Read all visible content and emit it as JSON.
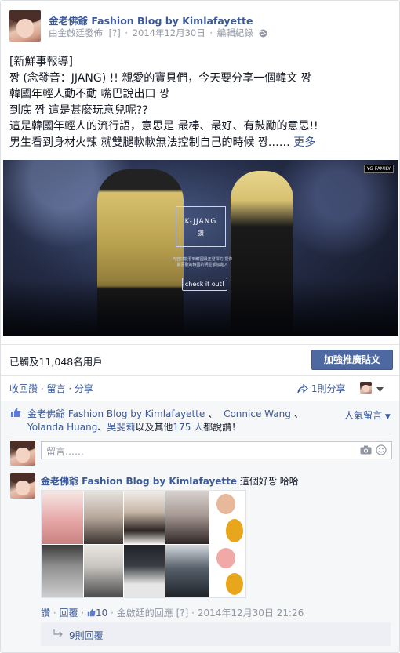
{
  "post": {
    "author": "金老佛爺 Fashion Blog by Kimlafayette",
    "meta_prefix": "由金啟廷發佈",
    "meta_help": "[?]",
    "date": "2014年12月30日",
    "edit_history": "編輯紀錄",
    "lines": [
      "[新鮮事報導]",
      "짱 (念發音：JJANG) !! 親愛的寶貝們，今天要分享一個韓文 짱",
      "韓國年輕人動不動 嘴巴說出口 짱",
      "到底 짱 這是甚麼玩意兒呢??",
      "這是韓國年輕人的流行語，意思是 最棒、最好、有鼓勵的意思!!",
      "男生看到身材火辣 就雙腿軟軟無法控制自己的時候 짱……"
    ],
    "more": "更多"
  },
  "hero": {
    "box_title": "K-JJANG",
    "box_sub": "讚",
    "box_tagline": "內容只能看到韓國最正發揮力 把你最喜歡的韓國的明星都加進入",
    "cta": "check it out!",
    "tag": "YG FAMILY"
  },
  "stats": {
    "reach": "已觸及11,048名用戶",
    "boost_label": "加強推廣貼文"
  },
  "actions": {
    "comment": "收回讚",
    "reply": "留言",
    "share": "分享",
    "shares": "1則分享",
    "sep": "·"
  },
  "likes": {
    "text_a": "金老佛爺 Fashion Blog by Kimlafayette",
    "sep1": "、",
    "text_b": "Connice Wang",
    "sep2": "、",
    "text_c": "Yolanda Huang",
    "sep3": "、",
    "text_d": "吳斐莉",
    "mid": "以及其他",
    "count": "175 人",
    "suffix": "都說讚！",
    "sort": "人氣留言"
  },
  "comment_box": {
    "placeholder": "留言……"
  },
  "comment": {
    "author": "金老佛爺 Fashion Blog by Kimlafayette",
    "text": "這個好짱 哈哈",
    "like": "讚",
    "reply": "回覆",
    "like_count": "10",
    "by_label": "金啟廷的回應",
    "help": "[?]",
    "date": "2014年12月30日 21:26",
    "sep": "·"
  },
  "replies": {
    "label": "9則回覆"
  },
  "colors": {
    "link": "#3b5998",
    "boost_bg": "#4e69a2",
    "meta": "#9197a3",
    "panel": "#f6f7f9"
  }
}
